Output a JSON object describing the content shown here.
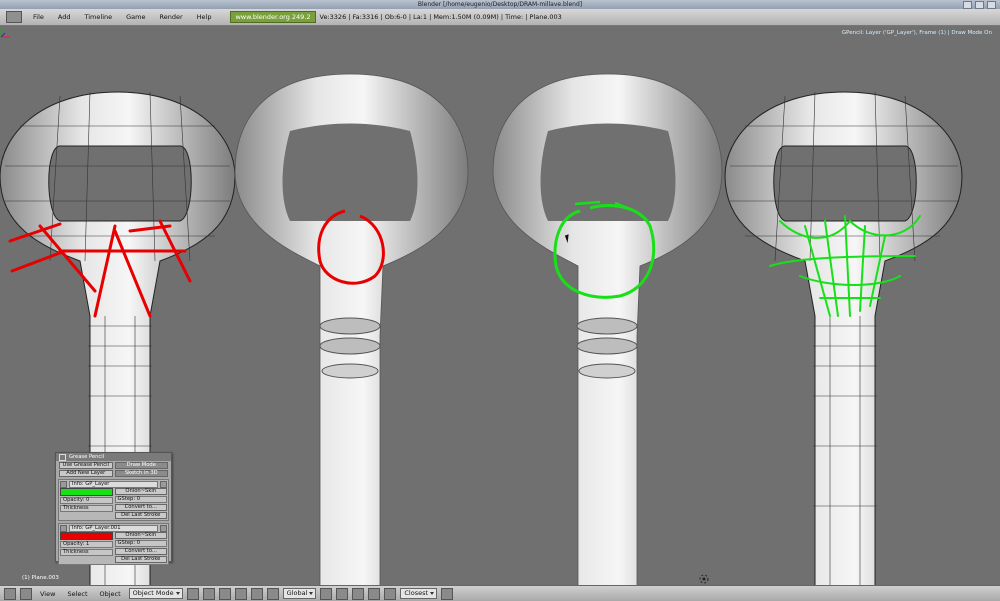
{
  "window": {
    "title": "Blender [/home/eugenio/Desktop/DRAM-millave.blend]"
  },
  "menubar": {
    "items": [
      "File",
      "Add",
      "Timeline",
      "Game",
      "Render",
      "Help"
    ],
    "site": "www.blender.org 249.2",
    "stats": "Ve:3326 | Fa:3316 | Ob:6-0 | La:1  | Mem:1.50M (0.09M)  | Time: | Plane.003"
  },
  "viewport": {
    "gp_status": "GPencil: Layer ('GP_Layer'), Frame (1) | Draw Mode On",
    "object_label": "(1) Plane.003",
    "stroke_colors": {
      "red": "#e80000",
      "green": "#18e018"
    }
  },
  "grease_pencil": {
    "title": "Grease Pencil",
    "use_grease_pencil": "Use Grease Pencil",
    "draw_mode": "Draw Mode",
    "add_new_layer": "Add New Layer",
    "sketch_in_3d": "Sketch in 3D",
    "layers": [
      {
        "name": "Info: GP_Layer",
        "color": "#18e018",
        "opacity": "Opacity: 0",
        "thickness": "Thickness",
        "onion": "Onion~Skin",
        "gstep": "GStep: 0",
        "convert": "Convert to...",
        "del": "Del Last Stroke"
      },
      {
        "name": "Info: GP_Layer.001",
        "color": "#e80000",
        "opacity": "Opacity: 1",
        "thickness": "Thickness",
        "onion": "Onion~Skin",
        "gstep": "GStep: 0",
        "convert": "Convert to...",
        "del": "Del Last Stroke"
      }
    ]
  },
  "bottombar": {
    "view": "View",
    "select": "Select",
    "object": "Object",
    "mode": "Object Mode",
    "orientation": "Global",
    "snap": "Closest"
  }
}
